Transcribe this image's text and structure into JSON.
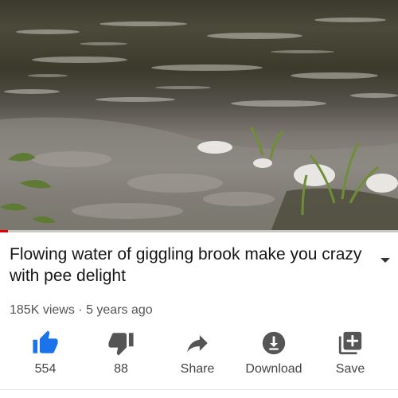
{
  "video": {
    "progress_fraction": 0.02
  },
  "details": {
    "title": "Flowing water of giggling brook make you crazy with pee delight",
    "views": "185K views",
    "separator": "·",
    "age": "5 years ago"
  },
  "actions": [
    {
      "icon": "thumbs-up-icon",
      "label": "554",
      "active": true
    },
    {
      "icon": "thumbs-down-icon",
      "label": "88"
    },
    {
      "icon": "share-icon",
      "label": "Share"
    },
    {
      "icon": "download-icon",
      "label": "Download"
    },
    {
      "icon": "save-playlist-icon",
      "label": "Save"
    }
  ],
  "colors": {
    "accent": "#1a73e8",
    "progress": "#e00000",
    "icon": "#555555"
  }
}
